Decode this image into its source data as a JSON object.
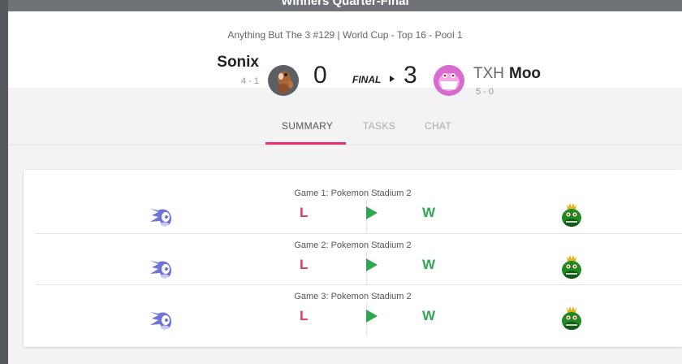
{
  "window": {
    "title": "Winners Quarter-Final"
  },
  "match": {
    "event": "Anything But The 3 #129 | World Cup - Top 16 - Pool 1",
    "status": "FINAL",
    "player1": {
      "name": "Sonix",
      "record": "4 - 1",
      "score": "0"
    },
    "player2": {
      "tag": "TXH",
      "name": "Moo",
      "record": "5 - 0",
      "score": "3"
    }
  },
  "tabs": [
    {
      "label": "SUMMARY",
      "active": true
    },
    {
      "label": "TASKS",
      "active": false
    },
    {
      "label": "CHAT",
      "active": false
    }
  ],
  "games": [
    {
      "label": "Game 1: Pokemon Stadium 2",
      "p1_result": "L",
      "p2_result": "W",
      "p1_char_icon": "sonic-icon",
      "p2_char_icon": "king-k-rool-icon"
    },
    {
      "label": "Game 2: Pokemon Stadium 2",
      "p1_result": "L",
      "p2_result": "W",
      "p1_char_icon": "sonic-icon",
      "p2_char_icon": "king-k-rool-icon"
    },
    {
      "label": "Game 3: Pokemon Stadium 2",
      "p1_result": "L",
      "p2_result": "W",
      "p1_char_icon": "sonic-icon",
      "p2_char_icon": "king-k-rool-icon"
    }
  ],
  "colors": {
    "accent": "#e6336a",
    "win": "#2ea84f",
    "loss": "#e6336a",
    "sonic": "#6e73d8",
    "krool": "#1f8a1f"
  }
}
